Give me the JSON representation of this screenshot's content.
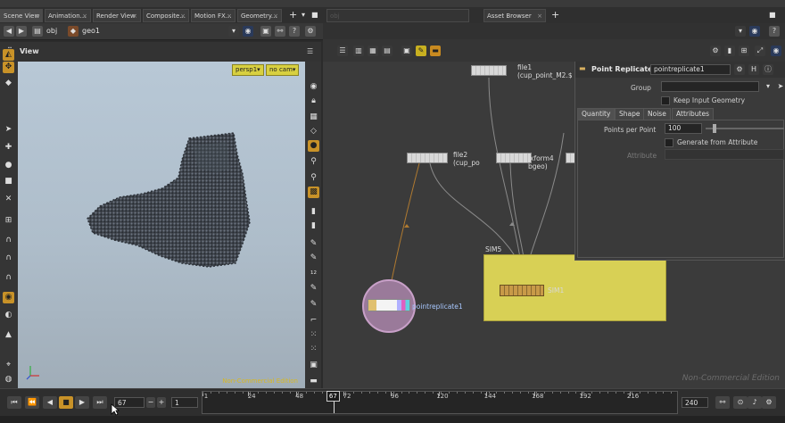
{
  "tabs_left": [
    {
      "label": "Scene View"
    },
    {
      "label": "Animation..."
    },
    {
      "label": "Render View"
    },
    {
      "label": "Composite..."
    },
    {
      "label": "Motion FX..."
    },
    {
      "label": "Geometry..."
    }
  ],
  "tabs_right": [
    {
      "label": "obj"
    },
    {
      "label": "Asset Browser"
    }
  ],
  "path": {
    "obj": "obj",
    "geo": "geo1"
  },
  "viewport": {
    "title": "View",
    "camera": "persp1▾",
    "cam_select": "no cam▾",
    "watermark": "Non-Commercial Edition"
  },
  "network": {
    "nodes": {
      "file1_name": "file1",
      "file1_path": "(cup_point_M2.$",
      "file2_name": "file2",
      "file2_path": "(cup_po",
      "xform_name": "xform4",
      "xform_path": "bgeo)",
      "sim_box": "SIM5",
      "sim_node": "SIM1",
      "replicate": "pointreplicate1"
    },
    "watermark": "Non-Commercial Edition"
  },
  "params": {
    "node_type": "Point Replicate",
    "node_name": "pointreplicate1",
    "group_label": "Group",
    "keep_label": "Keep Input Geometry",
    "tabs": [
      "Quantity",
      "Shape",
      "Noise",
      "Attributes"
    ],
    "ppp_label": "Points per Point",
    "ppp_value": "100",
    "gen_label": "Generate from Attribute",
    "attr_label": "Attribute"
  },
  "timeline": {
    "current_frame": "67",
    "start_frame": "1",
    "end_frame": "240",
    "marker": "67",
    "ticks": [
      "1",
      "24",
      "48",
      "72",
      "96",
      "120",
      "144",
      "168",
      "192",
      "216"
    ]
  }
}
